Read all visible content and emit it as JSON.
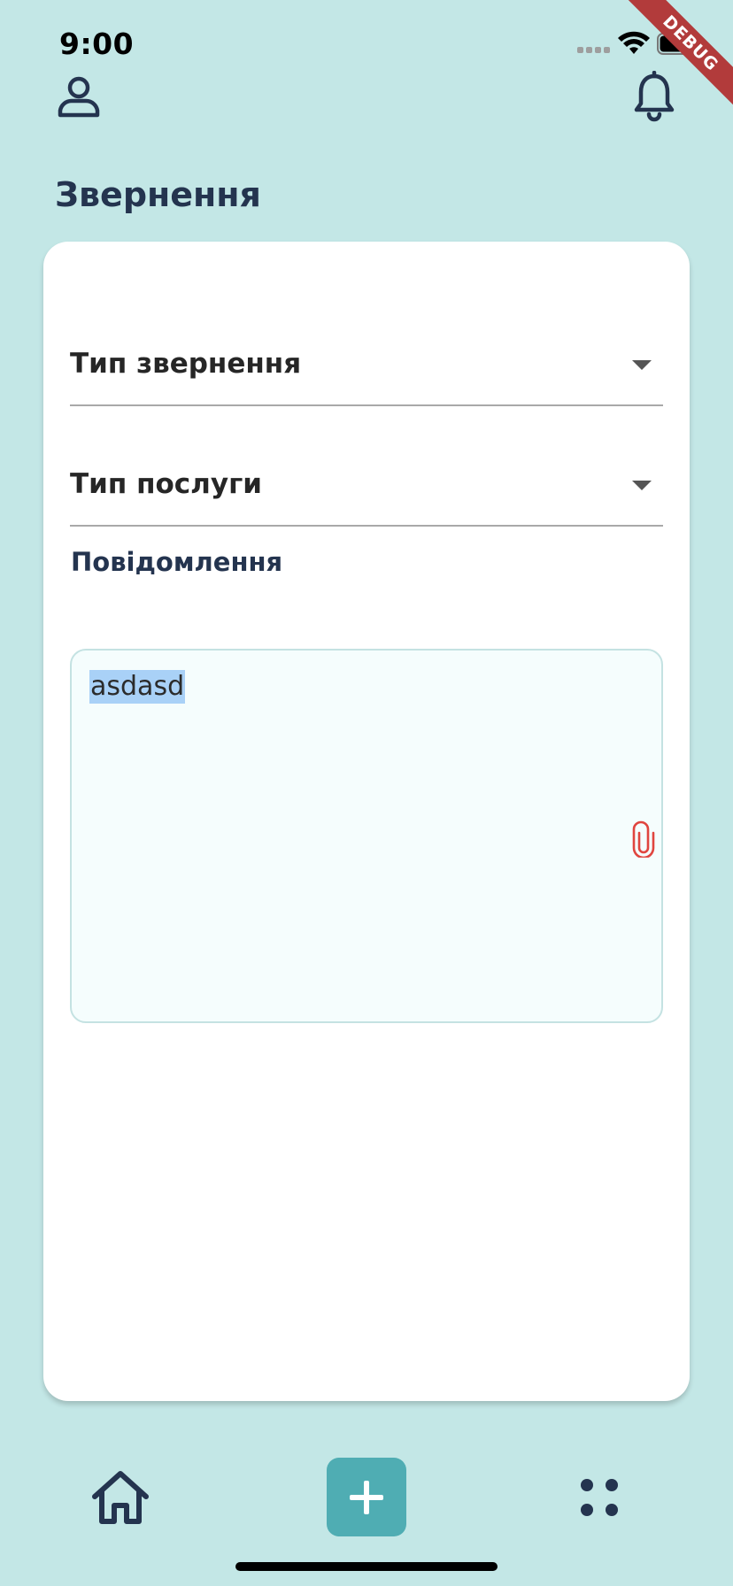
{
  "status_bar": {
    "time": "9:00"
  },
  "debug_banner": "DEBUG",
  "header": {
    "title": "Звернення"
  },
  "form": {
    "request_type_label": "Тип звернення",
    "service_type_label": "Тип послуги",
    "message_label": "Повідомлення",
    "message_value": "asdasd"
  },
  "icons": {
    "profile": "profile-icon",
    "notifications": "bell-icon",
    "attach": "paperclip-icon",
    "home": "home-icon",
    "add": "plus-icon",
    "menu": "menu-dots-icon"
  },
  "colors": {
    "background": "#c3e7e6",
    "accent": "#4fadb3",
    "text_dark": "#24344f",
    "attach_icon": "#e0453f",
    "selection": "#a9d1f7"
  }
}
